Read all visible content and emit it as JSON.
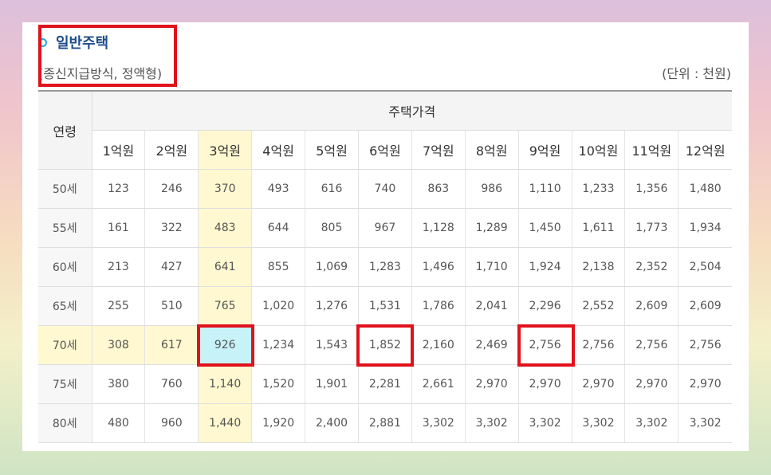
{
  "header": {
    "title": "일반주택",
    "subtitle": "(종신지급방식, 정액형)",
    "unit": "(단위 : 천원)"
  },
  "table": {
    "age_header": "연령",
    "price_header": "주택가격",
    "columns": [
      "1억원",
      "2억원",
      "3억원",
      "4억원",
      "5억원",
      "6억원",
      "7억원",
      "8억원",
      "9억원",
      "10억원",
      "11억원",
      "12억원"
    ],
    "rows": [
      {
        "age": "50세",
        "values": [
          "123",
          "246",
          "370",
          "493",
          "616",
          "740",
          "863",
          "986",
          "1,110",
          "1,233",
          "1,356",
          "1,480"
        ]
      },
      {
        "age": "55세",
        "values": [
          "161",
          "322",
          "483",
          "644",
          "805",
          "967",
          "1,128",
          "1,289",
          "1,450",
          "1,611",
          "1,773",
          "1,934"
        ]
      },
      {
        "age": "60세",
        "values": [
          "213",
          "427",
          "641",
          "855",
          "1,069",
          "1,283",
          "1,496",
          "1,710",
          "1,924",
          "2,138",
          "2,352",
          "2,504"
        ]
      },
      {
        "age": "65세",
        "values": [
          "255",
          "510",
          "765",
          "1,020",
          "1,276",
          "1,531",
          "1,786",
          "2,041",
          "2,296",
          "2,552",
          "2,609",
          "2,609"
        ]
      },
      {
        "age": "70세",
        "values": [
          "308",
          "617",
          "926",
          "1,234",
          "1,543",
          "1,852",
          "2,160",
          "2,469",
          "2,756",
          "2,756",
          "2,756",
          "2,756"
        ]
      },
      {
        "age": "75세",
        "values": [
          "380",
          "760",
          "1,140",
          "1,520",
          "1,901",
          "2,281",
          "2,661",
          "2,970",
          "2,970",
          "2,970",
          "2,970",
          "2,970"
        ]
      },
      {
        "age": "80세",
        "values": [
          "480",
          "960",
          "1,440",
          "1,920",
          "2,400",
          "2,881",
          "3,302",
          "3,302",
          "3,302",
          "3,302",
          "3,302",
          "3,302"
        ]
      }
    ]
  },
  "colors": {
    "highlight_yellow": "#fff8d0",
    "highlight_cyan": "#c6f2f8",
    "annotation_red": "#e0121c",
    "title_blue": "#1f4e8c"
  }
}
